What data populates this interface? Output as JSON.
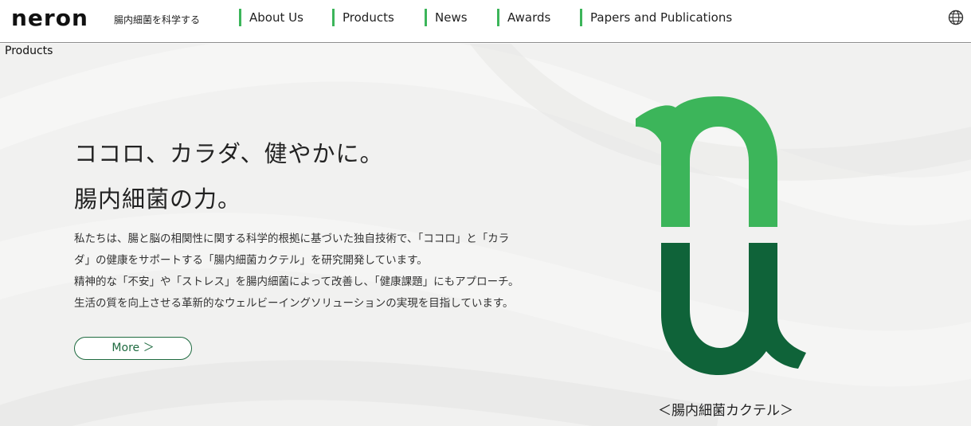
{
  "header": {
    "logo_text": "neron",
    "tagline": "腸内細菌を科学する",
    "nav": [
      {
        "label": "About Us"
      },
      {
        "label": "Products"
      },
      {
        "label": "News"
      },
      {
        "label": "Awards"
      },
      {
        "label": "Papers and Publications"
      }
    ],
    "icons": {
      "language": "globe-icon"
    }
  },
  "section": {
    "label": "Products"
  },
  "hero": {
    "headline1": "ココロ、カラダ、健やかに。",
    "headline2": "腸内細菌の力。",
    "body": [
      "私たちは、腸と脳の相関性に関する科学的根拠に基づいた独自技術で、「ココロ」と「カラ",
      "ダ」の健康をサポートする「腸内細菌カクテル」を研究開発しています。",
      "精神的な「不安」や「ストレス」を腸内細菌によって改善し、「健康課題」にもアプローチ。",
      "生活の質を向上させる革新的なウェルビーイングソリューションの実現を目指しています。"
    ],
    "more_label": "More ＞",
    "mark_caption": "＜腸内細菌カクテル＞"
  },
  "colors": {
    "accent_green": "#3cb55a",
    "dark_green": "#0f6339",
    "text": "#222222",
    "hero_bg": "#f1f1f0"
  }
}
